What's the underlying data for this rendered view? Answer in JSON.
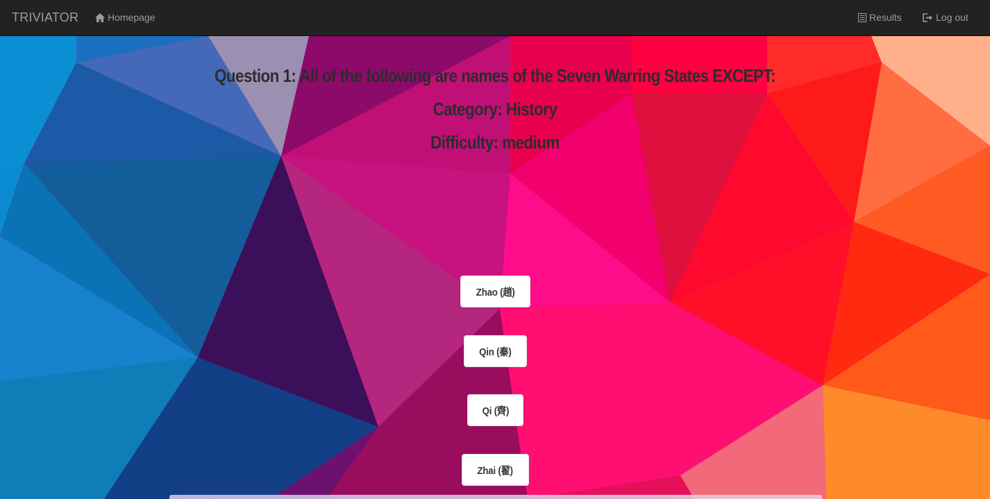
{
  "navbar": {
    "brand": "TRIVIATOR",
    "home_label": "Homepage",
    "home_icon": "home-icon",
    "results_label": "Results",
    "results_icon": "list-icon",
    "logout_label": "Log out",
    "logout_icon": "logout-icon"
  },
  "question": {
    "title": "Question 1: All of the following are names of the Seven Warring States EXCEPT:",
    "category": "Category: History",
    "difficulty": "Difficulty: medium"
  },
  "answers": [
    {
      "label": "Zhao (趙)"
    },
    {
      "label": "Qin (秦)"
    },
    {
      "label": "Qi (齊)"
    },
    {
      "label": "Zhai (翟)"
    }
  ],
  "colors": {
    "navbar_bg": "#222222",
    "navbar_text": "#9d9d9d",
    "heading_text": "#2c2c2c",
    "button_bg": "#ffffff"
  }
}
